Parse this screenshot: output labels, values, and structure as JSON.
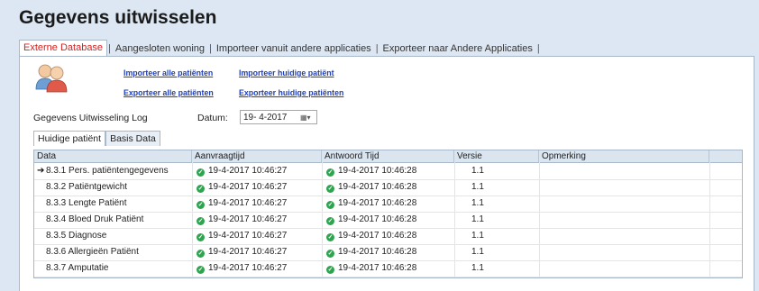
{
  "page_title": "Gegevens uitwisselen",
  "tabs": [
    {
      "label": "Externe Database",
      "active": true
    },
    {
      "label": "Aangesloten woning",
      "active": false
    },
    {
      "label": "Importeer vanuit andere applicaties",
      "active": false
    },
    {
      "label": "Exporteer naar Andere Applicaties",
      "active": false
    }
  ],
  "links": {
    "import_all": "Importeer alle patiënten",
    "import_current": "Importeer huidige patiënt",
    "export_all": "Exporteer alle patiënten",
    "export_current": "Exporteer huidige patiënten"
  },
  "log_label": "Gegevens Uitwisseling Log",
  "date_label": "Datum:",
  "date_value": "19- 4-2017",
  "subtabs": [
    {
      "label": "Huidige patiënt",
      "active": true
    },
    {
      "label": "Basis Data",
      "active": false
    }
  ],
  "table": {
    "columns": [
      "Data",
      "Aanvraagtijd",
      "Antwoord Tijd",
      "Versie",
      "Opmerking"
    ],
    "rows": [
      {
        "data": "8.3.1 Pers. patiëntengegevens",
        "aanvraag": "19-4-2017 10:46:27",
        "antwoord": "19-4-2017 10:46:28",
        "versie": "1.1",
        "opmerking": "",
        "current": true
      },
      {
        "data": "8.3.2 Patiëntgewicht",
        "aanvraag": "19-4-2017 10:46:27",
        "antwoord": "19-4-2017 10:46:28",
        "versie": "1.1",
        "opmerking": "",
        "current": false
      },
      {
        "data": "8.3.3 Lengte Patiënt",
        "aanvraag": "19-4-2017 10:46:27",
        "antwoord": "19-4-2017 10:46:28",
        "versie": "1.1",
        "opmerking": "",
        "current": false
      },
      {
        "data": "8.3.4 Bloed Druk Patiënt",
        "aanvraag": "19-4-2017 10:46:27",
        "antwoord": "19-4-2017 10:46:28",
        "versie": "1.1",
        "opmerking": "",
        "current": false
      },
      {
        "data": "8.3.5 Diagnose",
        "aanvraag": "19-4-2017 10:46:27",
        "antwoord": "19-4-2017 10:46:28",
        "versie": "1.1",
        "opmerking": "",
        "current": false
      },
      {
        "data": "8.3.6 Allergieën Patiënt",
        "aanvraag": "19-4-2017 10:46:27",
        "antwoord": "19-4-2017 10:46:28",
        "versie": "1.1",
        "opmerking": "",
        "current": false
      },
      {
        "data": "8.3.7 Amputatie",
        "aanvraag": "19-4-2017 10:46:27",
        "antwoord": "19-4-2017 10:46:28",
        "versie": "1.1",
        "opmerking": "",
        "current": false
      }
    ]
  },
  "icons": {
    "users": "users-icon",
    "status_ok": "check-circle-icon",
    "current_row": "arrow-right-icon",
    "calendar": "calendar-icon"
  },
  "colors": {
    "active_tab": "#d62020",
    "link": "#1f3fbd",
    "status_ok": "#2fa44f"
  }
}
